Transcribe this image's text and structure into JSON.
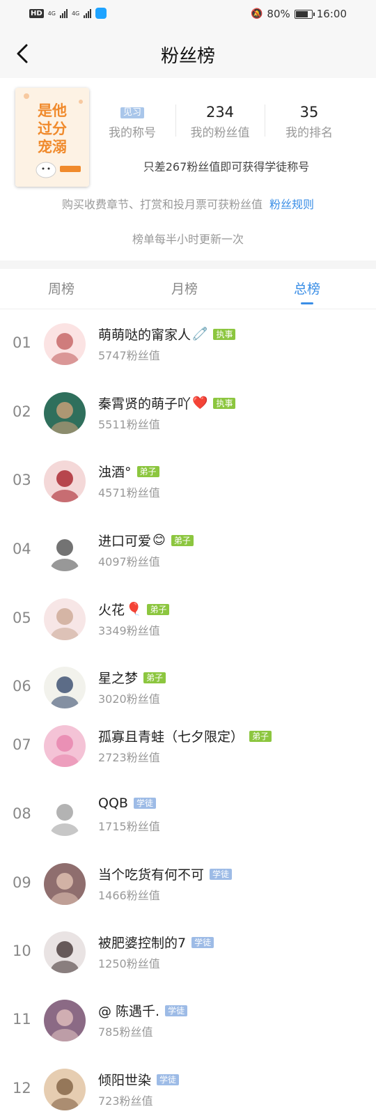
{
  "status_bar": {
    "network_hd": "HD",
    "network_sim1": "4G",
    "network_sim2": "4G",
    "battery": "80%",
    "battery_level": 0.8,
    "time": "16:00"
  },
  "nav": {
    "title": "粉丝榜",
    "back_icon": "chevron-left-icon"
  },
  "book": {
    "cover_text": [
      "是他",
      "过分",
      "宠溺"
    ]
  },
  "summary": {
    "stats": [
      {
        "value": "见习",
        "label": "我的称号"
      },
      {
        "value": "234",
        "label": "我的粉丝值"
      },
      {
        "value": "35",
        "label": "我的排名"
      }
    ],
    "progress_text": "只差267粉丝值即可获得学徒称号",
    "rules_text": "购买收费章节、打赏和投月票可获粉丝值",
    "rules_link": "粉丝规则",
    "update_note": "榜单每半小时更新一次"
  },
  "tabs": [
    {
      "label": "周榜",
      "active": false
    },
    {
      "label": "月榜",
      "active": false
    },
    {
      "label": "总榜",
      "active": true
    }
  ],
  "colors": {
    "accent": "#3a8ee6",
    "badge_zhishi": "#8cc63f",
    "badge_dizi": "#8cc63f",
    "badge_xuetu": "#9dbbe6"
  },
  "fans": [
    {
      "rank": "01",
      "name": "萌萌哒的甯家人",
      "emoji": "🧷",
      "badge": "执事",
      "score": "5747粉丝值"
    },
    {
      "rank": "02",
      "name": "秦霄贤的萌子吖",
      "emoji": "❤️",
      "badge": "执事",
      "score": "5511粉丝值"
    },
    {
      "rank": "03",
      "name": "浊酒°",
      "emoji": "",
      "badge": "弟子",
      "score": "4571粉丝值"
    },
    {
      "rank": "04",
      "name": "进口可爱",
      "emoji": "😊",
      "badge": "弟子",
      "score": "4097粉丝值"
    },
    {
      "rank": "05",
      "name": "火花",
      "emoji": "🎈",
      "badge": "弟子",
      "score": "3349粉丝值"
    },
    {
      "rank": "06",
      "name": "星之梦",
      "emoji": "",
      "badge": "弟子",
      "score": "3020粉丝值"
    },
    {
      "rank": "07",
      "name": "孤寡且青蛙（七夕限定）",
      "emoji": "",
      "badge": "弟子",
      "score": "2723粉丝值"
    },
    {
      "rank": "08",
      "name": "QQB",
      "emoji": "",
      "badge": "学徒",
      "score": "1715粉丝值"
    },
    {
      "rank": "09",
      "name": "当个吃货有何不可",
      "emoji": "",
      "badge": "学徒",
      "score": "1466粉丝值"
    },
    {
      "rank": "10",
      "name": "被肥婆控制的7",
      "emoji": "",
      "badge": "学徒",
      "score": "1250粉丝值"
    },
    {
      "rank": "11",
      "name": "@ 陈遇千.",
      "emoji": "",
      "badge": "学徒",
      "score": "785粉丝值"
    },
    {
      "rank": "12",
      "name": "倾阳世染",
      "emoji": "",
      "badge": "学徒",
      "score": "723粉丝值"
    }
  ]
}
